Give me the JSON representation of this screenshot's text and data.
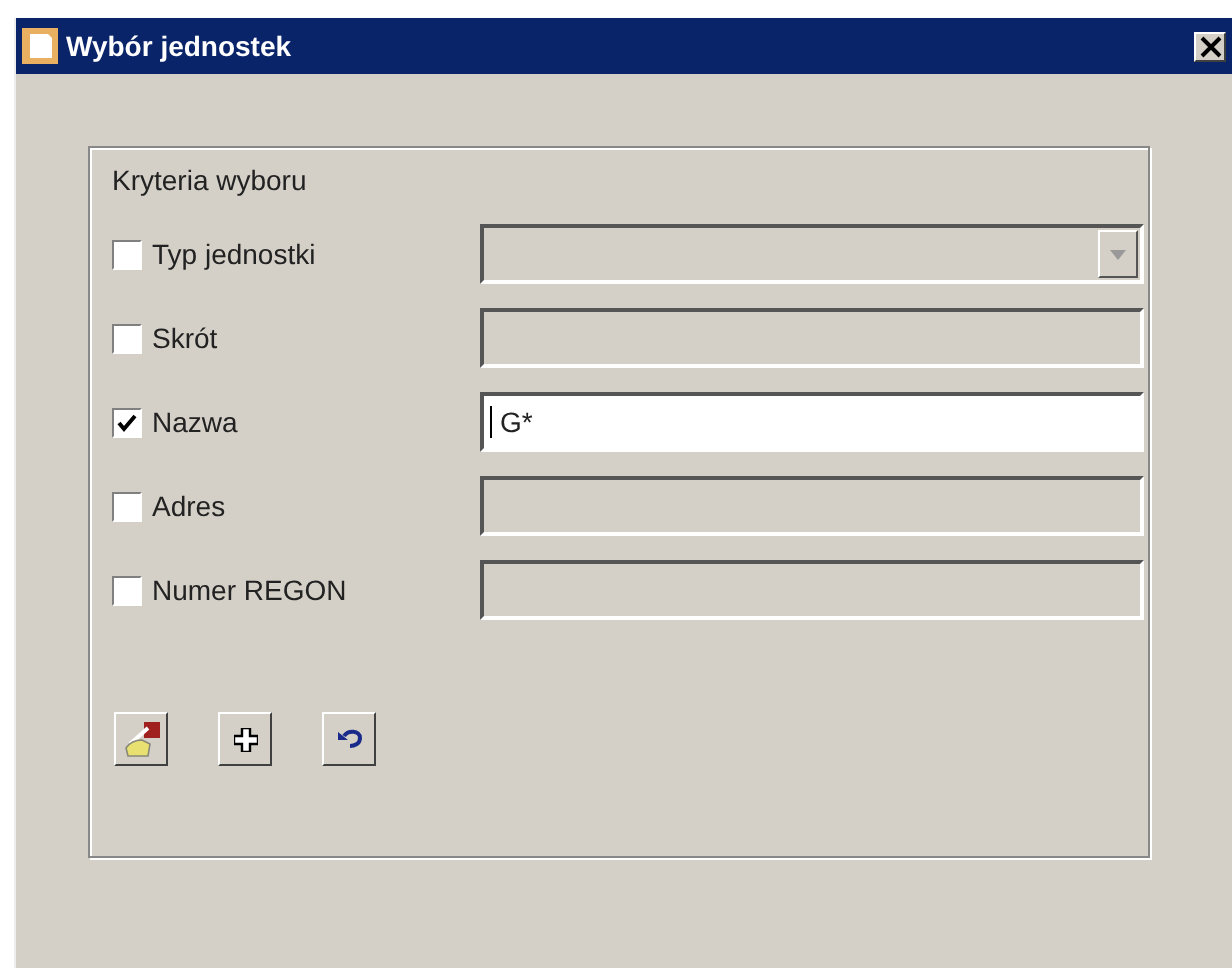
{
  "window": {
    "title": "Wybór jednostek"
  },
  "group": {
    "title": "Kryteria wyboru"
  },
  "criteria": [
    {
      "label": "Typ jednostki",
      "checked": false,
      "kind": "combo"
    },
    {
      "label": "Skrót",
      "checked": false,
      "kind": "text"
    },
    {
      "label": "Nazwa",
      "checked": true,
      "kind": "text",
      "value": "G*"
    },
    {
      "label": "Adres",
      "checked": false,
      "kind": "text"
    },
    {
      "label": "Numer REGON",
      "checked": false,
      "kind": "text"
    }
  ],
  "buttons": [
    {
      "kind": "pick"
    },
    {
      "kind": "add"
    },
    {
      "kind": "undo"
    }
  ]
}
